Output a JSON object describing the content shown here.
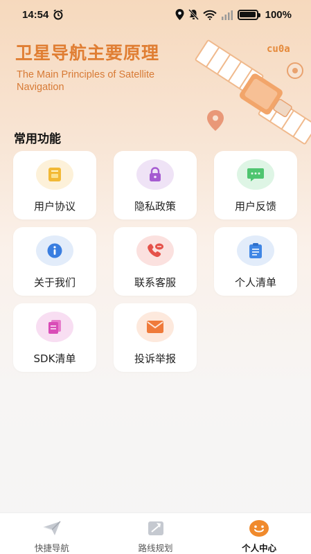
{
  "status_bar": {
    "time": "14:54",
    "battery": "100%",
    "icons": [
      "alarm-icon",
      "location-icon",
      "mute-icon",
      "wifi-icon",
      "signal-icon",
      "battery-icon"
    ]
  },
  "banner": {
    "title": "卫星导航主要原理",
    "subtitle": "The Main Principles of Satellite Navigation",
    "watermark": "cu0a"
  },
  "section": {
    "title": "常用功能"
  },
  "functions": [
    {
      "label": "用户协议",
      "icon": "document-icon",
      "bg": "#fdf1d9",
      "color": "#f2b935"
    },
    {
      "label": "隐私政策",
      "icon": "lock-icon",
      "bg": "#efe3f6",
      "color": "#a55ad1"
    },
    {
      "label": "用户反馈",
      "icon": "chat-icon",
      "bg": "#def5e5",
      "color": "#4fc570"
    },
    {
      "label": "关于我们",
      "icon": "info-icon",
      "bg": "#e2ecfa",
      "color": "#3a7ee0"
    },
    {
      "label": "联系客服",
      "icon": "phone-icon",
      "bg": "#fbe1df",
      "color": "#e5524a"
    },
    {
      "label": "个人清单",
      "icon": "clipboard-icon",
      "bg": "#e2ecfa",
      "color": "#3f86e5"
    },
    {
      "label": "SDK清单",
      "icon": "files-icon",
      "bg": "#f8def2",
      "color": "#d94cb7"
    },
    {
      "label": "投诉举报",
      "icon": "mail-icon",
      "bg": "#fde9dd",
      "color": "#ef7a3a"
    }
  ],
  "bottom_nav": [
    {
      "label": "快捷导航",
      "icon": "send-icon",
      "active": false
    },
    {
      "label": "路线规划",
      "icon": "map-icon",
      "active": false
    },
    {
      "label": "个人中心",
      "icon": "smile-icon",
      "active": true
    }
  ],
  "colors": {
    "accent": "#e07e33",
    "active_nav": "#f08a2c"
  }
}
